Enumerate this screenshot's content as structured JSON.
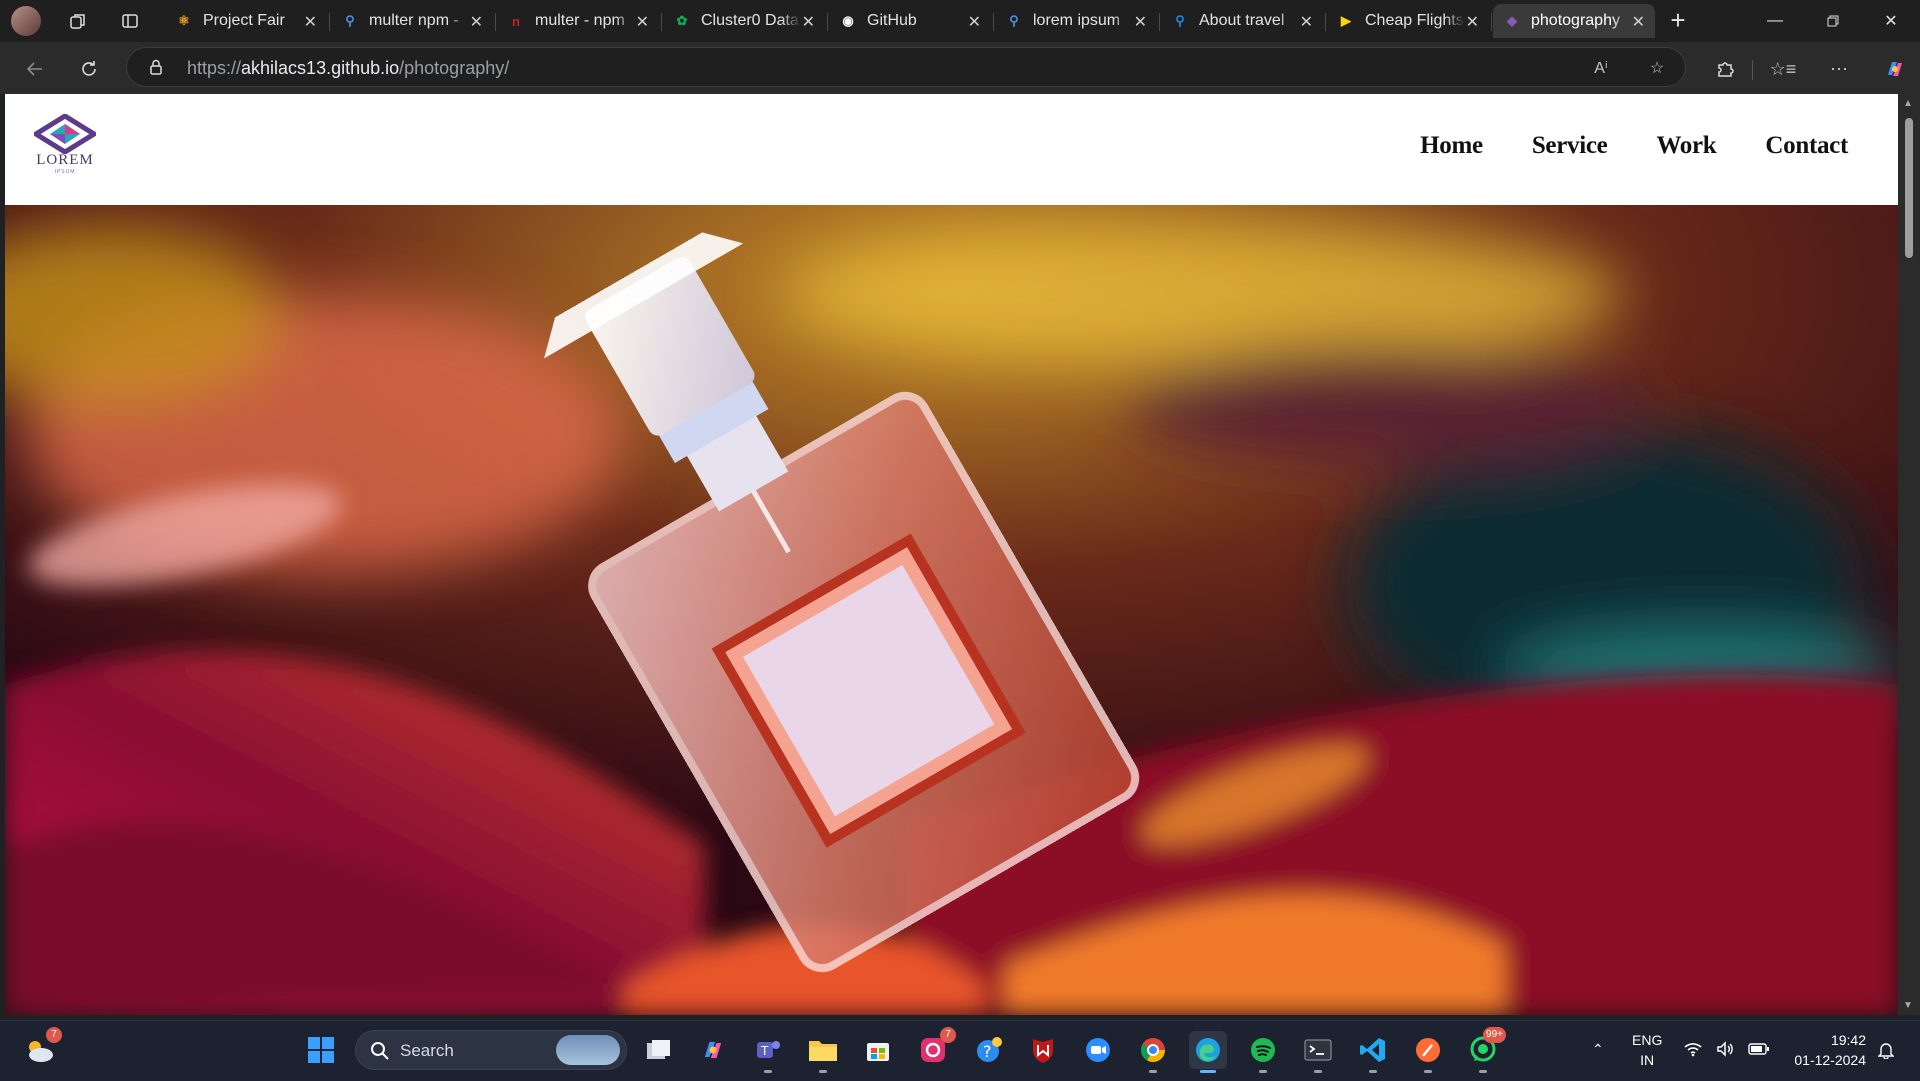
{
  "browser": {
    "tabs": [
      {
        "title": "Project Fair",
        "favicon": "react-icon",
        "favicon_color": "#f5a623",
        "active": false
      },
      {
        "title": "multer npm - ",
        "favicon": "search-icon",
        "favicon_color": "#4a90d9",
        "active": false
      },
      {
        "title": "multer - npm",
        "favicon": "npm-icon",
        "favicon_color": "#c12127",
        "active": false
      },
      {
        "title": "Cluster0 Data",
        "favicon": "mongodb-leaf-icon",
        "favicon_color": "#13aa52",
        "active": false
      },
      {
        "title": "GitHub",
        "favicon": "github-icon",
        "favicon_color": "#ffffff",
        "active": false
      },
      {
        "title": "lorem ipsum",
        "favicon": "search-icon",
        "favicon_color": "#4a90d9",
        "active": false
      },
      {
        "title": "About travel",
        "favicon": "search-icon",
        "favicon_color": "#1e88e5",
        "active": false
      },
      {
        "title": "Cheap Flights",
        "favicon": "kayak-icon",
        "favicon_color": "#ffd400",
        "active": false
      },
      {
        "title": "photography",
        "favicon": "lorem-logo-icon",
        "favicon_color": "#8a5bb5",
        "active": true
      }
    ],
    "new_tab": "+",
    "url": {
      "scheme": "https://",
      "host": "akhilacs13.github.io",
      "path": "/photography/"
    }
  },
  "site": {
    "logo": {
      "text": "LOREM",
      "sub": "IPSUM"
    },
    "nav": [
      "Home",
      "Service",
      "Work",
      "Contact"
    ],
    "hero": {
      "subject": "perfume-bottle-photo"
    }
  },
  "taskbar": {
    "weather_badge": "7",
    "search_label": "Search",
    "instagram_badge": "7",
    "whatsapp_badge": "99+",
    "lang": {
      "line1": "ENG",
      "line2": "IN"
    },
    "time": "19:42",
    "date": "01-12-2024"
  }
}
